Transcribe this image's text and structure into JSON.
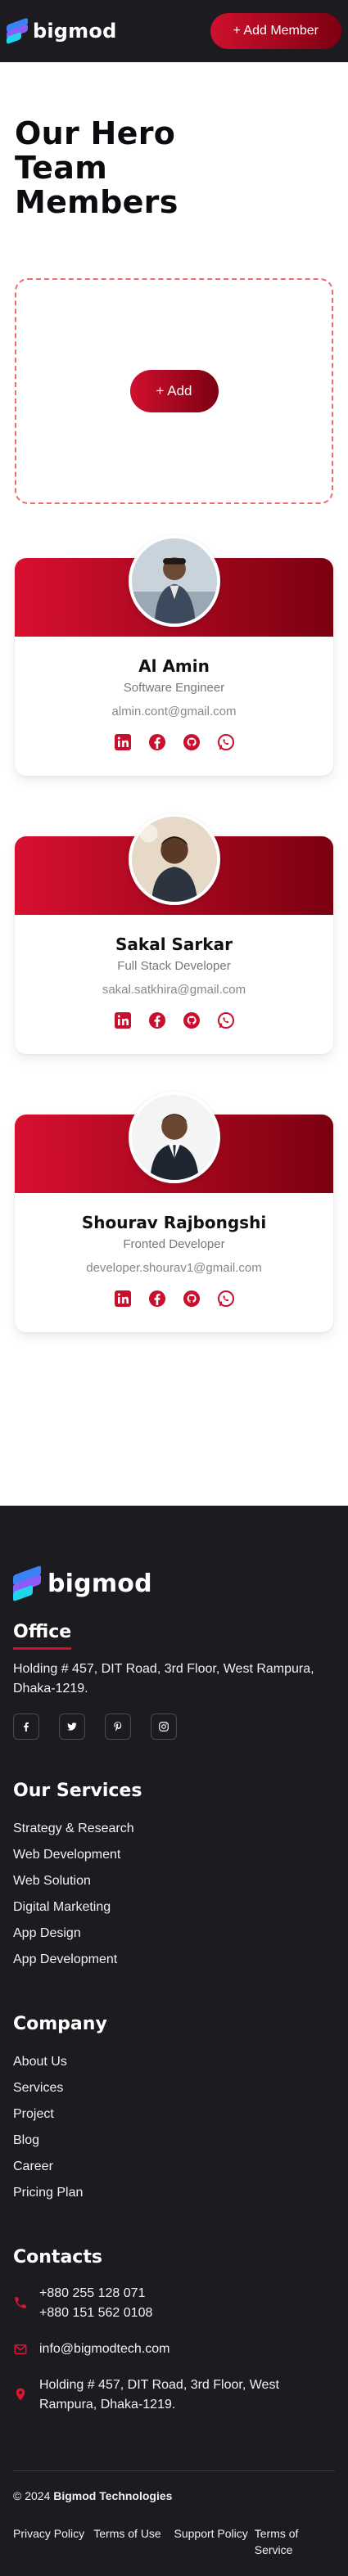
{
  "header": {
    "logo_text": "bigmod",
    "add_member_label": "+ Add Member"
  },
  "page_title": "Our Hero Team Members",
  "add_area": {
    "add_label": "+ Add"
  },
  "members": [
    {
      "name": "Al Amin",
      "role": "Software Engineer",
      "email": "almin.cont@gmail.com"
    },
    {
      "name": "Sakal Sarkar",
      "role": "Full Stack Developer",
      "email": "sakal.satkhira@gmail.com"
    },
    {
      "name": "Shourav Rajbongshi",
      "role": "Fronted Developer",
      "email": "developer.shourav1@gmail.com"
    }
  ],
  "social_icons": [
    "linkedin-icon",
    "facebook-icon",
    "github-icon",
    "whatsapp-icon"
  ],
  "colors": {
    "brand_red": "#d0102e",
    "brand_dark_red": "#7d0012",
    "footer_bg": "#1b1b20"
  },
  "footer": {
    "logo_text": "bigmod",
    "office": {
      "heading": "Office",
      "address": "Holding # 457, DIT Road, 3rd Floor, West Rampura, Dhaka-1219."
    },
    "social_icons": [
      "facebook-icon",
      "twitter-icon",
      "pinterest-icon",
      "instagram-icon"
    ],
    "services": {
      "heading": "Our Services",
      "items": [
        "Strategy & Research",
        "Web Development",
        "Web Solution",
        "Digital Marketing",
        "App Design",
        "App Development"
      ]
    },
    "company": {
      "heading": "Company",
      "items": [
        "About Us",
        "Services",
        "Project",
        "Blog",
        "Career",
        "Pricing Plan"
      ]
    },
    "contacts": {
      "heading": "Contacts",
      "phone_1": "+880 255 128 071",
      "phone_2": "+880 151 562 0108",
      "email": "info@bigmodtech.com",
      "address": "Holding # 457, DIT Road, 3rd Floor, West Rampura, Dhaka-1219."
    },
    "copyright_prefix": "© 2024",
    "copyright_company": "Bigmod Technologies",
    "legal_links": [
      "Privacy Policy",
      "Terms of Use",
      "Support Policy",
      "Terms of Service"
    ]
  }
}
